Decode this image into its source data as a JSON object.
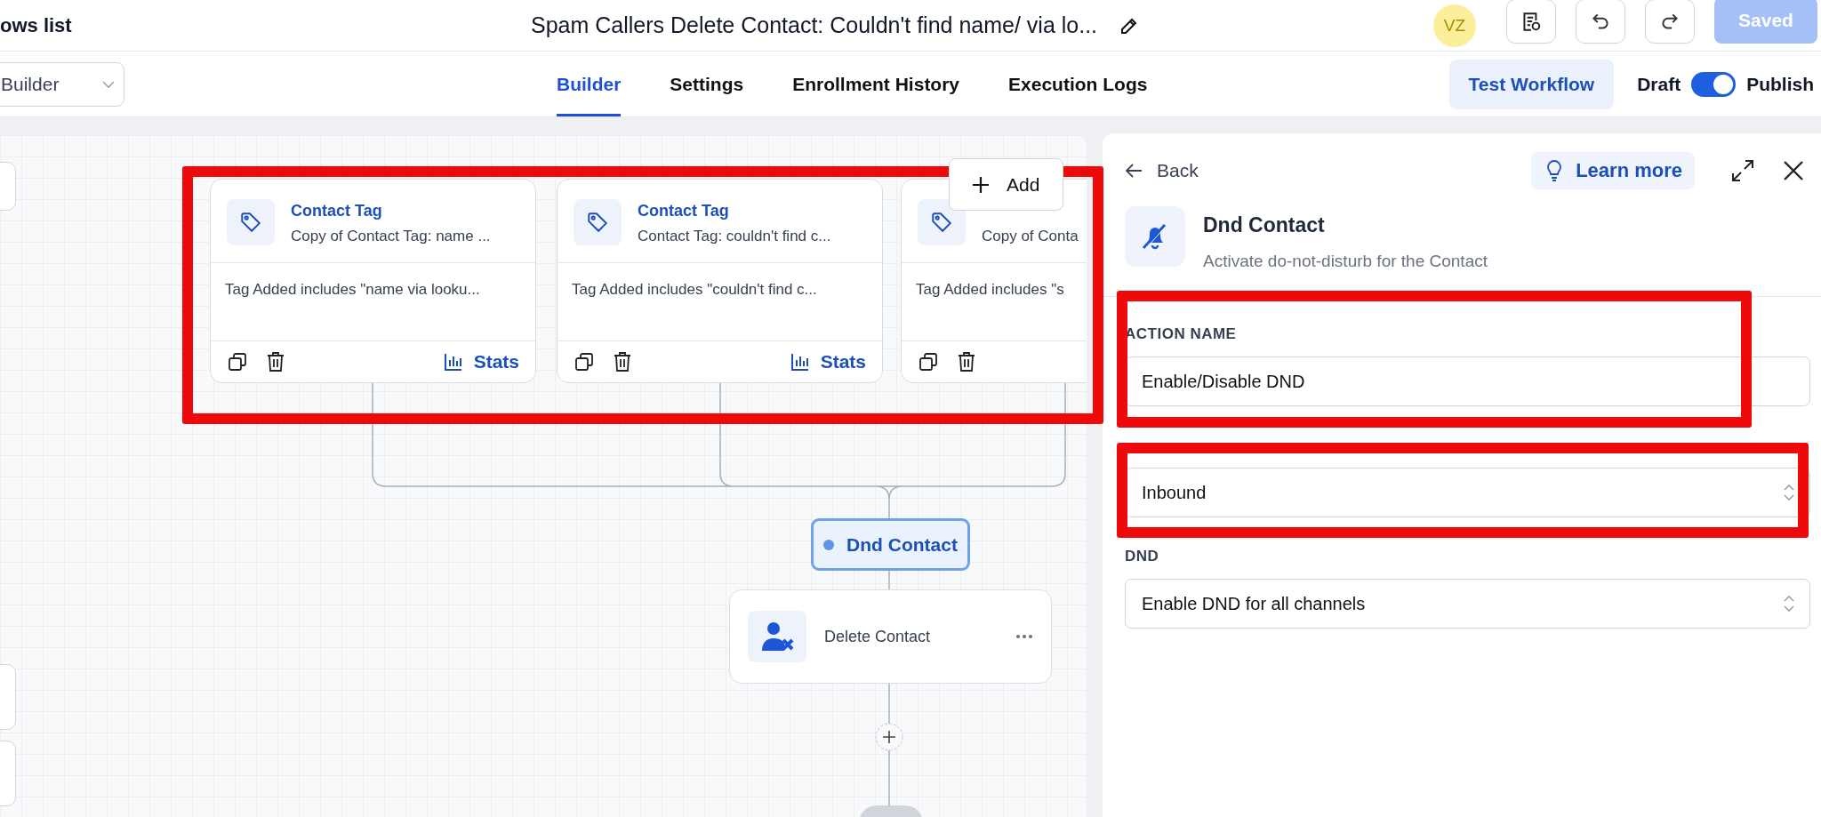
{
  "header": {
    "back_link": "ows list",
    "title": "Spam Callers Delete Contact: Couldn't find name/ via lo...",
    "avatar": "VZ",
    "save_button": "Saved"
  },
  "toolbar": {
    "view_select": "Builder",
    "tabs": [
      {
        "label": "Builder",
        "selected": true
      },
      {
        "label": "Settings",
        "selected": false
      },
      {
        "label": "Enrollment History",
        "selected": false
      },
      {
        "label": "Execution Logs",
        "selected": false
      }
    ],
    "test_button": "Test Workflow",
    "draft_label": "Draft",
    "publish_toggle": {
      "on": true
    },
    "publish_label": "Publish"
  },
  "canvas": {
    "highlighted": true,
    "add_button": "Add",
    "cards": [
      {
        "title": "Contact Tag",
        "subtitle": "Copy of Contact Tag: name ...",
        "condition": "Tag Added includes \"name via looku...",
        "stats": "Stats"
      },
      {
        "title": "Contact Tag",
        "subtitle": "Contact Tag: couldn't find c...",
        "condition": "Tag Added includes \"couldn't find c...",
        "stats": "Stats"
      },
      {
        "subtitle": "Copy of Conta",
        "condition": "Tag Added includes \"s"
      }
    ],
    "dnd_node": "Dnd Contact",
    "delete_node": "Delete Contact"
  },
  "panel": {
    "back": "Back",
    "learn_more": "Learn more",
    "title": "Dnd Contact",
    "description": "Activate do-not-disturb for the Contact",
    "fields": [
      {
        "kind": "input",
        "label": "ACTION NAME",
        "value": "Enable/Disable DND",
        "highlighted": true
      },
      {
        "kind": "select",
        "value": "Inbound",
        "highlighted": true
      },
      {
        "kind": "select",
        "label": "DND",
        "value": "Enable DND for all channels",
        "highlighted": false
      }
    ]
  }
}
